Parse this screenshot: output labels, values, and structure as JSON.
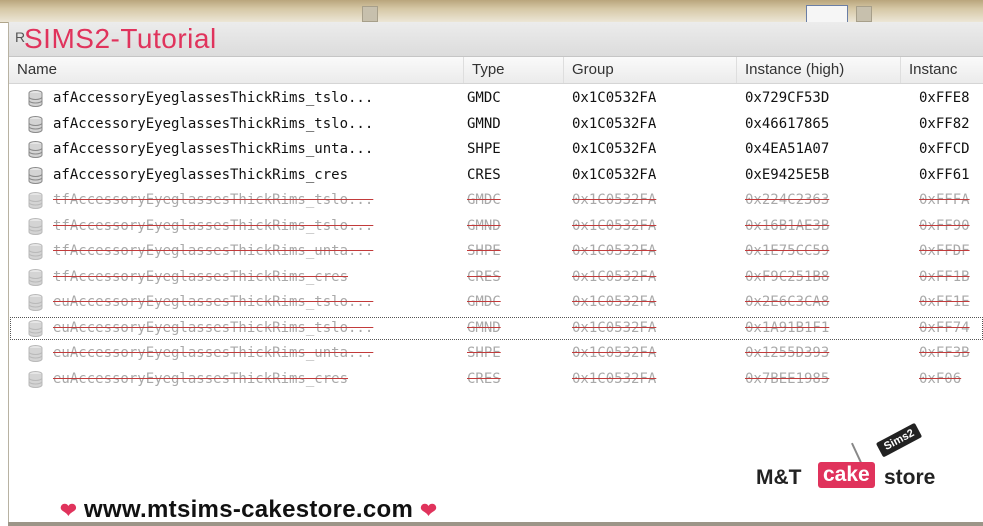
{
  "tab": {
    "prefix": "R",
    "watermark_title": "SIMS2-Tutorial"
  },
  "columns": [
    "Name",
    "Type",
    "Group",
    "Instance (high)",
    "Instanc"
  ],
  "rows": [
    {
      "name": "afAccessoryEyeglassesThickRims_tslo...",
      "type": "GMDC",
      "group": "0x1C0532FA",
      "instance_high": "0x729CF53D",
      "instance": "0xFFE8",
      "deleted": false
    },
    {
      "name": "afAccessoryEyeglassesThickRims_tslo...",
      "type": "GMND",
      "group": "0x1C0532FA",
      "instance_high": "0x46617865",
      "instance": "0xFF82",
      "deleted": false
    },
    {
      "name": "afAccessoryEyeglassesThickRims_unta...",
      "type": "SHPE",
      "group": "0x1C0532FA",
      "instance_high": "0x4EA51A07",
      "instance": "0xFFCD",
      "deleted": false
    },
    {
      "name": "afAccessoryEyeglassesThickRims_cres",
      "type": "CRES",
      "group": "0x1C0532FA",
      "instance_high": "0xE9425E5B",
      "instance": "0xFF61",
      "deleted": false
    },
    {
      "name": "tfAccessoryEyeglassesThickRims_tslo...",
      "type": "GMDC",
      "group": "0x1C0532FA",
      "instance_high": "0x224C2363",
      "instance": "0xFFFA",
      "deleted": true
    },
    {
      "name": "tfAccessoryEyeglassesThickRims_tslo...",
      "type": "GMND",
      "group": "0x1C0532FA",
      "instance_high": "0x16B1AE3B",
      "instance": "0xFF90",
      "deleted": true
    },
    {
      "name": "tfAccessoryEyeglassesThickRims_unta...",
      "type": "SHPE",
      "group": "0x1C0532FA",
      "instance_high": "0x1E75CC59",
      "instance": "0xFFDF",
      "deleted": true
    },
    {
      "name": "tfAccessoryEyeglassesThickRims_cres",
      "type": "CRES",
      "group": "0x1C0532FA",
      "instance_high": "0xF9C251B8",
      "instance": "0xFF1B",
      "deleted": true
    },
    {
      "name": "euAccessoryEyeglassesThickRims_tslo...",
      "type": "GMDC",
      "group": "0x1C0532FA",
      "instance_high": "0x2E6C3CA8",
      "instance": "0xFF1E",
      "deleted": true
    },
    {
      "name": "euAccessoryEyeglassesThickRims_tslo...",
      "type": "GMND",
      "group": "0x1C0532FA",
      "instance_high": "0x1A91B1F1",
      "instance": "0xFF74",
      "deleted": true,
      "focused": true
    },
    {
      "name": "euAccessoryEyeglassesThickRims_unta...",
      "type": "SHPE",
      "group": "0x1C0532FA",
      "instance_high": "0x1255D393",
      "instance": "0xFF3B",
      "deleted": true
    },
    {
      "name": "euAccessoryEyeglassesThickRims_cres",
      "type": "CRES",
      "group": "0x1C0532FA",
      "instance_high": "0x7BEE1985",
      "instance": "0xF06",
      "deleted": true
    }
  ],
  "logo": {
    "mt": "M&T",
    "cake": "cake",
    "store": "store",
    "tag": "Sims2"
  },
  "footer": {
    "url": "www.mtsims-cakestore.com",
    "heart": "❤"
  },
  "colors": {
    "accent": "#e0335c",
    "deleted_text": "#a9a9a9",
    "strike": "#c23b3b"
  },
  "row_icon": "database-icon"
}
